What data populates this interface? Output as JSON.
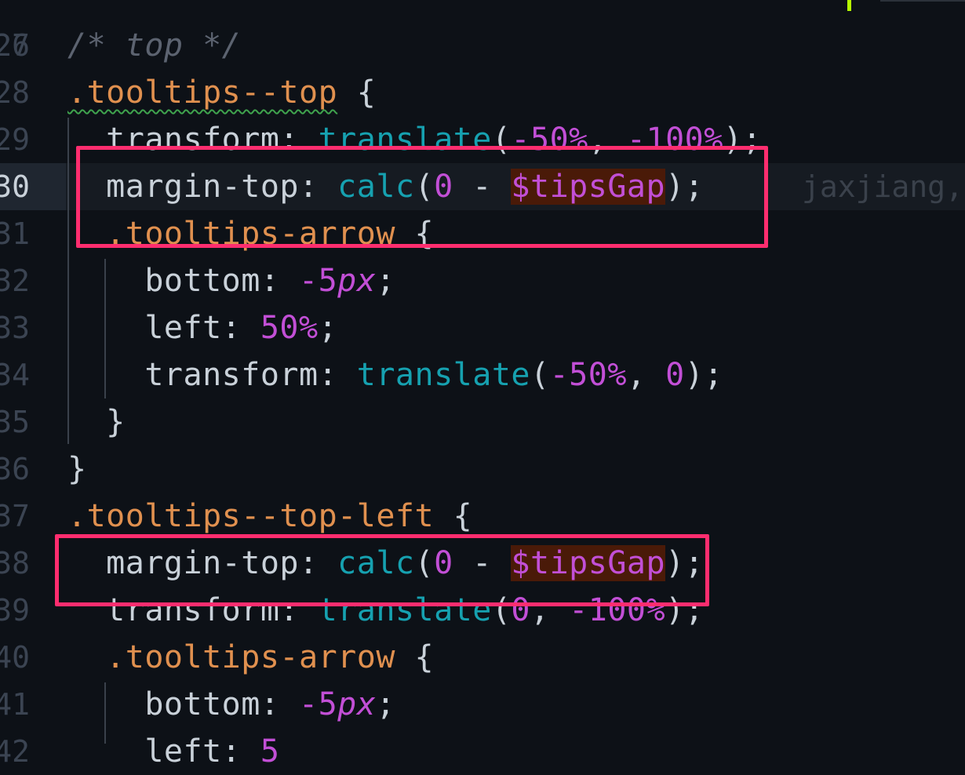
{
  "editor": {
    "partial_top_line_number": "26",
    "lines": [
      {
        "number": "27",
        "tokens": [
          {
            "t": "/* top */",
            "c": "comment"
          }
        ]
      },
      {
        "number": "28",
        "tokens": [
          {
            "t": ".tooltips--top",
            "c": "selector",
            "squiggle": true
          },
          {
            "t": " {",
            "c": "punct"
          }
        ]
      },
      {
        "number": "29",
        "tokens": [
          {
            "t": "  transform",
            "c": "prop"
          },
          {
            "t": ": ",
            "c": "punct"
          },
          {
            "t": "translate",
            "c": "func"
          },
          {
            "t": "(",
            "c": "punct"
          },
          {
            "t": "-50%",
            "c": "num"
          },
          {
            "t": ", ",
            "c": "punct"
          },
          {
            "t": "-100%",
            "c": "num"
          },
          {
            "t": ");",
            "c": "punct"
          }
        ]
      },
      {
        "number": "30",
        "current": true,
        "blame": "jaxjiang,",
        "tokens": [
          {
            "t": "  margin-top",
            "c": "prop"
          },
          {
            "t": ": ",
            "c": "punct"
          },
          {
            "t": "calc",
            "c": "func"
          },
          {
            "t": "(",
            "c": "punct"
          },
          {
            "t": "0",
            "c": "num"
          },
          {
            "t": " - ",
            "c": "punct"
          },
          {
            "t": "$tipsGap",
            "c": "var"
          },
          {
            "t": ");",
            "c": "punct"
          }
        ]
      },
      {
        "number": "31",
        "tokens": [
          {
            "t": "  .tooltips-arrow",
            "c": "selector"
          },
          {
            "t": " {",
            "c": "punct"
          }
        ]
      },
      {
        "number": "32",
        "tokens": [
          {
            "t": "    bottom",
            "c": "prop"
          },
          {
            "t": ": ",
            "c": "punct"
          },
          {
            "t": "-5",
            "c": "num"
          },
          {
            "t": "px",
            "c": "unit"
          },
          {
            "t": ";",
            "c": "punct"
          }
        ]
      },
      {
        "number": "33",
        "tokens": [
          {
            "t": "    left",
            "c": "prop"
          },
          {
            "t": ": ",
            "c": "punct"
          },
          {
            "t": "50%",
            "c": "num"
          },
          {
            "t": ";",
            "c": "punct"
          }
        ]
      },
      {
        "number": "34",
        "tokens": [
          {
            "t": "    transform",
            "c": "prop"
          },
          {
            "t": ": ",
            "c": "punct"
          },
          {
            "t": "translate",
            "c": "func"
          },
          {
            "t": "(",
            "c": "punct"
          },
          {
            "t": "-50%",
            "c": "num"
          },
          {
            "t": ", ",
            "c": "punct"
          },
          {
            "t": "0",
            "c": "num"
          },
          {
            "t": ");",
            "c": "punct"
          }
        ]
      },
      {
        "number": "35",
        "tokens": [
          {
            "t": "  }",
            "c": "punct"
          }
        ]
      },
      {
        "number": "36",
        "tokens": [
          {
            "t": "}",
            "c": "punct"
          }
        ]
      },
      {
        "number": "37",
        "tokens": [
          {
            "t": ".tooltips--top-left",
            "c": "selector"
          },
          {
            "t": " {",
            "c": "punct"
          }
        ]
      },
      {
        "number": "38",
        "tokens": [
          {
            "t": "  margin-top",
            "c": "prop"
          },
          {
            "t": ": ",
            "c": "punct"
          },
          {
            "t": "calc",
            "c": "func"
          },
          {
            "t": "(",
            "c": "punct"
          },
          {
            "t": "0",
            "c": "num"
          },
          {
            "t": " - ",
            "c": "punct"
          },
          {
            "t": "$tipsGap",
            "c": "var"
          },
          {
            "t": ");",
            "c": "punct"
          }
        ]
      },
      {
        "number": "39",
        "tokens": [
          {
            "t": "  transform",
            "c": "prop"
          },
          {
            "t": ": ",
            "c": "punct"
          },
          {
            "t": "translate",
            "c": "func"
          },
          {
            "t": "(",
            "c": "punct"
          },
          {
            "t": "0",
            "c": "num"
          },
          {
            "t": ", ",
            "c": "punct"
          },
          {
            "t": "-100%",
            "c": "num"
          },
          {
            "t": ");",
            "c": "punct"
          }
        ]
      },
      {
        "number": "40",
        "tokens": [
          {
            "t": "  .tooltips-arrow",
            "c": "selector"
          },
          {
            "t": " {",
            "c": "punct"
          }
        ]
      },
      {
        "number": "41",
        "tokens": [
          {
            "t": "    bottom",
            "c": "prop"
          },
          {
            "t": ": ",
            "c": "punct"
          },
          {
            "t": "-5",
            "c": "num"
          },
          {
            "t": "px",
            "c": "unit"
          },
          {
            "t": ";",
            "c": "punct"
          }
        ]
      },
      {
        "number": "42",
        "tokens": [
          {
            "t": "    left",
            "c": "prop"
          },
          {
            "t": ": ",
            "c": "punct"
          },
          {
            "t": "5",
            "c": "num"
          }
        ]
      }
    ]
  },
  "colors": {
    "background": "#0d1117",
    "selector": "#e0904f",
    "function": "#16a1b0",
    "number": "#c24fd6",
    "highlight_box": "#ff2d6f",
    "variable_bg": "#4a1a08"
  }
}
